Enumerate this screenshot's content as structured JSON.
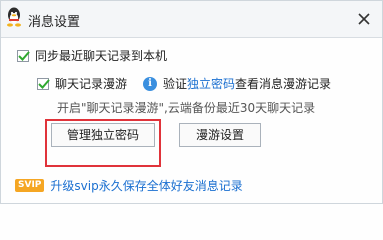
{
  "window": {
    "title": "消息设置",
    "icon": "qq-penguin-icon"
  },
  "sync": {
    "label": "同步最近聊天记录到本机",
    "checked": true
  },
  "roaming": {
    "label": "聊天记录漫游",
    "checked": true,
    "verify_prefix": "验证",
    "verify_link": "独立密码",
    "verify_suffix": "查看消息漫游记录",
    "hint": "开启\"聊天记录漫游\",云端备份最近30天聊天记录"
  },
  "buttons": {
    "manage_password": "管理独立密码",
    "roaming_settings": "漫游设置"
  },
  "promo": {
    "badge": "SVIP",
    "text": "升级svip永久保存全体好友消息记录"
  },
  "colors": {
    "accent": "#1a6fd0",
    "highlight": "#e0333a",
    "badge": "#f5a623",
    "check": "#2fa82f"
  }
}
